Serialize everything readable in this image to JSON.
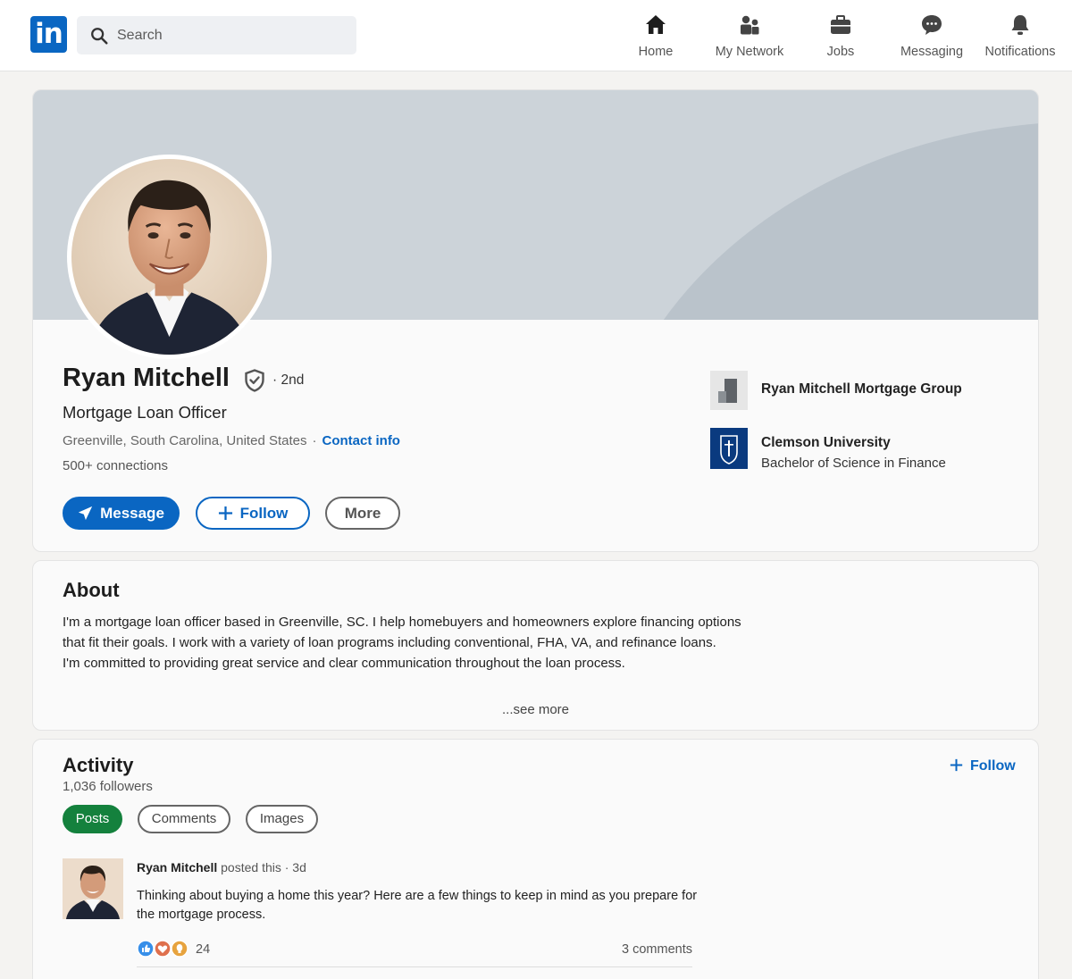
{
  "nav": {
    "logo_text": "in",
    "search_placeholder": "Search",
    "items": [
      {
        "label": "Home",
        "icon": "home-icon"
      },
      {
        "label": "My Network",
        "icon": "network-icon"
      },
      {
        "label": "Jobs",
        "icon": "briefcase-icon"
      },
      {
        "label": "Messaging",
        "icon": "chat-icon"
      },
      {
        "label": "Notifications",
        "icon": "bell-icon"
      }
    ]
  },
  "profile": {
    "name": "Ryan Mitchell",
    "degree": "· 2nd",
    "headline": "Mortgage Loan Officer",
    "location": "Greenville, South Carolina, United States",
    "separator": "·",
    "contact_info": "Contact info",
    "connections": "500+ connections",
    "buttons": {
      "message": "Message",
      "follow": "Follow",
      "more": "More"
    },
    "experience": [
      {
        "name": "Ryan Mitchell Mortgage Group",
        "subtitle": ""
      },
      {
        "name": "Clemson University",
        "subtitle": "Bachelor of Science in Finance"
      }
    ]
  },
  "about": {
    "title": "About",
    "paragraph1": "I'm a mortgage loan officer based in Greenville, SC. I help homebuyers and homeowners explore financing options that fit their goals. I work with a variety of loan programs including conventional, FHA, VA, and refinance loans.",
    "paragraph2": "I'm committed to providing great service and clear communication throughout the loan process.",
    "see_more": "...see more"
  },
  "activity": {
    "title": "Activity",
    "followers": "1,036 followers",
    "follow_label": "Follow",
    "tabs": [
      "Posts",
      "Comments",
      "Images"
    ],
    "active_tab": "Posts",
    "post": {
      "author": "Ryan Mitchell",
      "action": " posted this",
      "time": " · 3d",
      "text": "Thinking about buying a home this year? Here are a few things to keep in mind as you prepare for the mortgage process.",
      "reaction_count": "24",
      "comments": "3 comments"
    }
  },
  "colors": {
    "brand": "#0a66c2",
    "active_pill": "#14813d",
    "banner": "#ccd3d9"
  }
}
